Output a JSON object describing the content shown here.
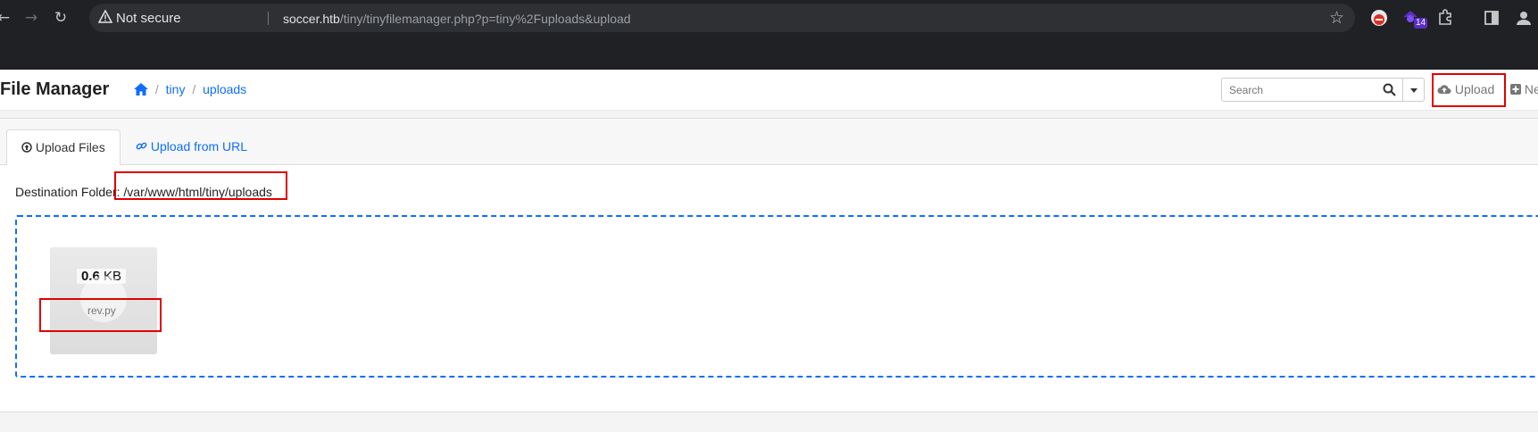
{
  "browser": {
    "security_label": "Not secure",
    "url_host": "soccer.htb",
    "url_path": "/tiny/tinyfilemanager.php?p=tiny%2Fuploads&upload",
    "extension_badge": "14"
  },
  "header": {
    "brand": "File Manager",
    "breadcrumb": [
      "tiny",
      "uploads"
    ],
    "search_placeholder": "Search",
    "upload_label": "Upload",
    "new_label": "Ne"
  },
  "tabs": [
    {
      "label": "Upload Files",
      "active": true
    },
    {
      "label": "Upload from URL",
      "active": false
    }
  ],
  "upload": {
    "destination_label": "Destination Folder:",
    "destination_path": "/var/www/html/tiny/uploads",
    "file": {
      "size_value": "0.6",
      "size_unit": "KB",
      "name": "rev.py"
    }
  },
  "colors": {
    "accent": "#0d6efd",
    "highlight": "#e00000"
  }
}
